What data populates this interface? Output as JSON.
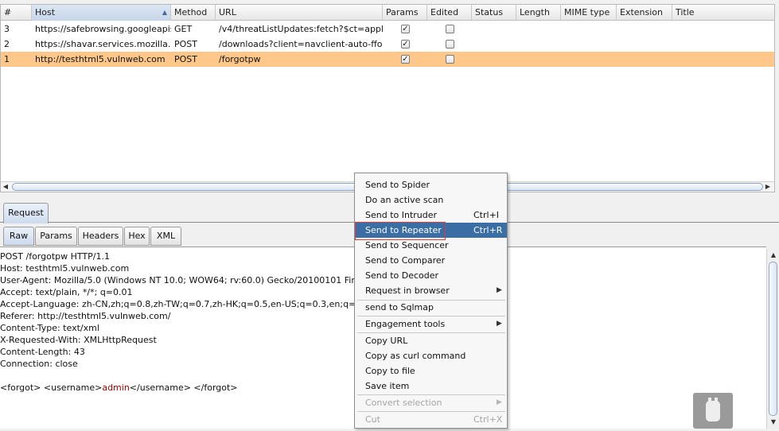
{
  "table": {
    "columns": [
      {
        "label": "#"
      },
      {
        "label": "Host"
      },
      {
        "label": "Method"
      },
      {
        "label": "URL"
      },
      {
        "label": "Params"
      },
      {
        "label": "Edited"
      },
      {
        "label": "Status"
      },
      {
        "label": "Length"
      },
      {
        "label": "MIME type"
      },
      {
        "label": "Extension"
      },
      {
        "label": "Title"
      }
    ],
    "rows": [
      {
        "num": "3",
        "host": "https://safebrowsing.googleapis...",
        "method": "GET",
        "url": "/v4/threatListUpdates:fetch?$ct=applic...",
        "params": true,
        "edited": false
      },
      {
        "num": "2",
        "host": "https://shavar.services.mozilla.c...",
        "method": "POST",
        "url": "/downloads?client=navclient-auto-ffox...",
        "params": true,
        "edited": false
      },
      {
        "num": "1",
        "host": "http://testhtml5.vulnweb.com",
        "method": "POST",
        "url": "/forgotpw",
        "params": true,
        "edited": false,
        "selected": true
      }
    ],
    "selected_row_color": "#ffc88a"
  },
  "request_tab": "Request",
  "sub_tabs": [
    "Raw",
    "Params",
    "Headers",
    "Hex",
    "XML"
  ],
  "active_sub_tab": "Raw",
  "raw_request": {
    "lines": [
      "POST /forgotpw HTTP/1.1",
      "Host: testhtml5.vulnweb.com",
      "User-Agent: Mozilla/5.0 (Windows NT 10.0; WOW64; rv:60.0) Gecko/20100101 Firefox/",
      "Accept: text/plain, */*; q=0.01",
      "Accept-Language: zh-CN,zh;q=0.8,zh-TW;q=0.7,zh-HK;q=0.5,en-US;q=0.3,en;q=0.2",
      "Referer: http://testhtml5.vulnweb.com/",
      "Content-Type: text/xml",
      "X-Requested-With: XMLHttpRequest",
      "Content-Length: 43",
      "Connection: close"
    ],
    "body_prefix": "<forgot> <username>",
    "body_value": "admin",
    "body_suffix": "</username> </forgot>"
  },
  "context_menu": {
    "items": [
      {
        "label": "Send to Spider"
      },
      {
        "label": "Do an active scan"
      },
      {
        "label": "Send to Intruder",
        "shortcut": "Ctrl+I"
      },
      {
        "label": "Send to Repeater",
        "shortcut": "Ctrl+R",
        "highlighted": true
      },
      {
        "label": "Send to Sequencer"
      },
      {
        "label": "Send to Comparer"
      },
      {
        "label": "Send to Decoder"
      },
      {
        "label": "Request in browser",
        "submenu": true
      },
      {
        "label": "send to Sqlmap"
      },
      {
        "label": "Engagement tools",
        "submenu": true
      },
      {
        "label": "Copy URL"
      },
      {
        "label": "Copy as curl command"
      },
      {
        "label": "Copy to file"
      },
      {
        "label": "Save item"
      },
      {
        "label": "Convert selection",
        "submenu": true,
        "disabled": true
      },
      {
        "label": "Cut",
        "shortcut": "Ctrl+X",
        "disabled": true
      }
    ],
    "highlight_color": "#3a6ea5",
    "focus_box_color": "#e33a3a"
  },
  "icons": {
    "sort": "sort-ascending-icon",
    "submenu": "submenu-arrow-icon",
    "widget": "plugin-icon"
  }
}
